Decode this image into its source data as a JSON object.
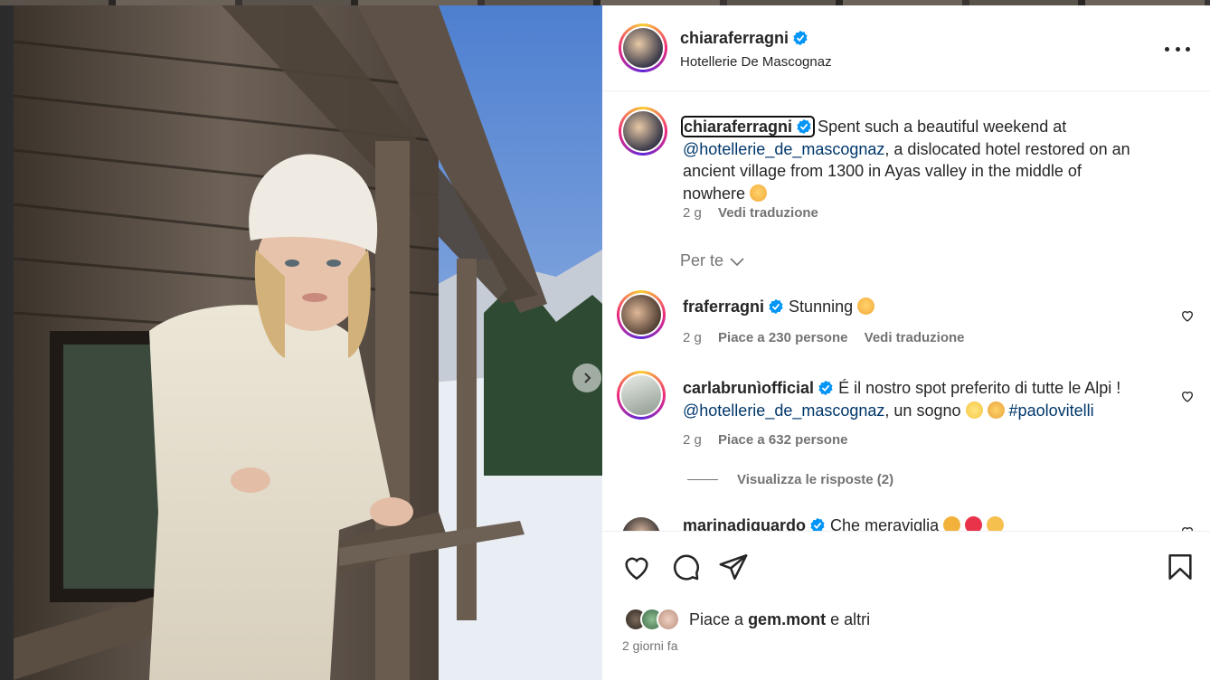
{
  "post": {
    "author": "chiaraferragni",
    "location": "Hotellerie De Mascognaz"
  },
  "caption": {
    "user": "chiaraferragni",
    "text_before": "Spent such a beautiful weekend at",
    "mention": "@hotellerie_de_mascognaz",
    "text_after": ", a dislocated hotel restored on an",
    "line3": "ancient village from 1300 in Ayas valley in the middle of",
    "line4": "nowhere",
    "time": "2 g",
    "translate": "Vedi traduzione"
  },
  "filter": {
    "label": "Per te"
  },
  "comments": [
    {
      "user": "fraferragni",
      "text": "Stunning",
      "time": "2 g",
      "likes": "Piace a 230 persone",
      "translate": "Vedi traduzione"
    },
    {
      "user": "carlabrunìofficial",
      "text": "É il nostro spot preferito di tutte le Alpi !",
      "mention": "@hotellerie_de_mascognaz",
      "text2": ", un sogno",
      "hashtag": "#paolovitelli",
      "time": "2 g",
      "likes": "Piace a 632 persone",
      "replies": "Visualizza le risposte (2)"
    },
    {
      "user": "marinadiguardo",
      "text": "Che meraviglia"
    }
  ],
  "footer": {
    "liked_prefix": "Piace a",
    "liked_user": "gem.mont",
    "liked_suffix": "e altri",
    "time_ago": "2 giorni fa"
  },
  "icons": {
    "like": "heart-icon",
    "comment": "comment-icon",
    "share": "send-icon",
    "save": "bookmark-icon",
    "more": "more-icon",
    "verified": "verified-badge-icon",
    "next": "chevron-right-icon"
  },
  "colors": {
    "link": "#00376b",
    "verified": "#0095f6",
    "muted": "#737373"
  }
}
